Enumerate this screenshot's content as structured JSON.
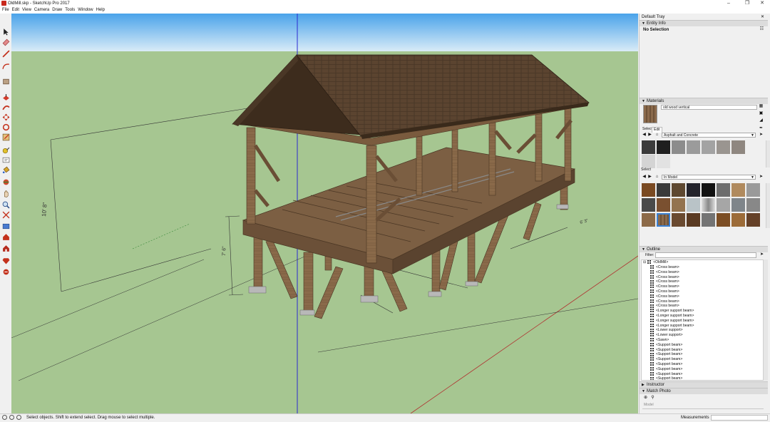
{
  "window": {
    "title": "OldMill.skp - SketchUp Pro 2017"
  },
  "menu": [
    "File",
    "Edit",
    "View",
    "Camera",
    "Draw",
    "Tools",
    "Window",
    "Help"
  ],
  "toolbar": {
    "tools": [
      "select-tool",
      "eraser-tool",
      "line-tool",
      "arc-tool",
      "rectangle-tool",
      "push-pull-tool",
      "offset-tool",
      "move-tool",
      "rotate-tool",
      "scale-tool",
      "tape-measure-tool",
      "text-tool",
      "paint-bucket-tool",
      "orbit-tool",
      "pan-tool",
      "zoom-tool",
      "zoom-extents-tool",
      "warehouse-tool",
      "extension-tool",
      "ruby-tool"
    ]
  },
  "viewport": {
    "sky_color": "#5aa8e6",
    "ground_color": "#a6c691",
    "dimensions": [
      "10' 8\"",
      "7' 6\"",
      "6' 3\""
    ]
  },
  "status": {
    "hint": "Select objects. Shift to extend select. Drag mouse to select multiple.",
    "measurements_label": "Measurements"
  },
  "tray": {
    "title": "Default Tray",
    "entity_info": {
      "label": "Entity Info",
      "selection": "No Selection"
    },
    "materials": {
      "label": "Materials",
      "current_name": "old wood vertical",
      "tabs": [
        "Select",
        "Edit"
      ],
      "collection": "Asphalt and Concrete",
      "select_label": "Select",
      "model_collection": "In Model"
    },
    "outline": {
      "label": "Outline",
      "filter_label": "Filter:",
      "root": "<OldMill>",
      "items": [
        "<Cross beam>",
        "<Cross beam>",
        "<Cross beam>",
        "<Cross beam>",
        "<Cross beam>",
        "<Cross beam>",
        "<Cross beam>",
        "<Cross beam>",
        "<Cross beam>",
        "<Longer support beam>",
        "<Longer support beam>",
        "<Longer support beam>",
        "<Longer support beam>",
        "<Lower support>",
        "<Lower support>",
        "<Sawn>",
        "<Support beam>",
        "<Support beam>",
        "<Support beam>",
        "<Support beam>",
        "<Support beam>",
        "<Support beam>",
        "<Support beam>",
        "<Support beam>"
      ]
    },
    "instructor": {
      "label": "Instructor"
    },
    "match_photo": {
      "label": "Match Photo",
      "model_label": "Model"
    }
  }
}
